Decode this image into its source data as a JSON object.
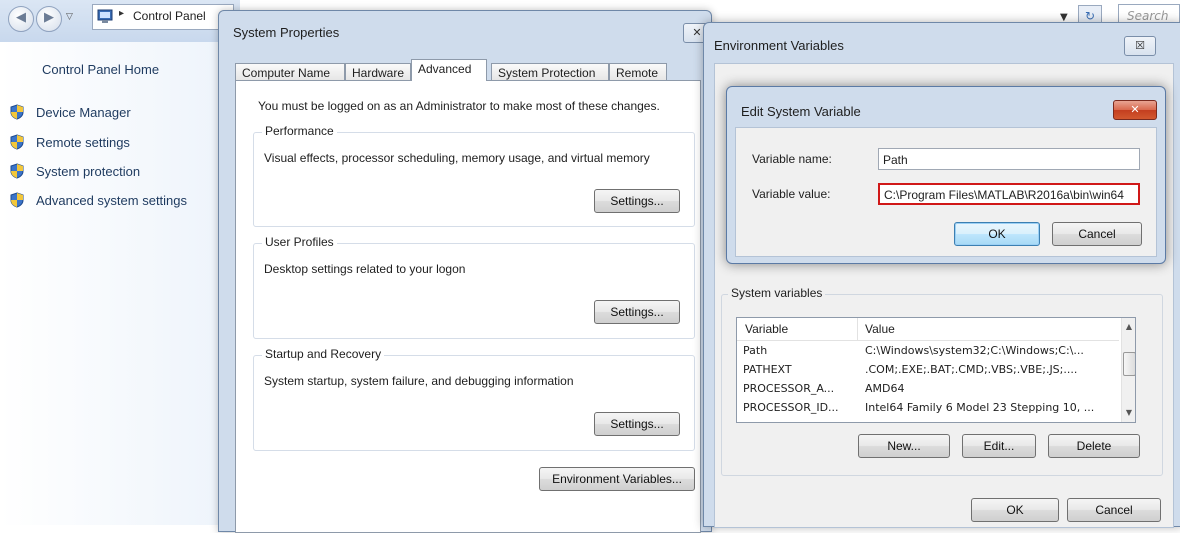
{
  "control_panel": {
    "breadcrumb": "Control Panel",
    "home_link": "Control Panel Home",
    "tasks": [
      {
        "label": "Device Manager"
      },
      {
        "label": "Remote settings"
      },
      {
        "label": "System protection"
      },
      {
        "label": "Advanced system settings"
      }
    ],
    "search_placeholder": "Search C"
  },
  "system_properties": {
    "title": "System Properties",
    "tabs": [
      {
        "label": "Computer Name"
      },
      {
        "label": "Hardware"
      },
      {
        "label": "Advanced"
      },
      {
        "label": "System Protection"
      },
      {
        "label": "Remote"
      }
    ],
    "active_tab": "Advanced",
    "admin_notice": "You must be logged on as an Administrator to make most of these changes.",
    "performance": {
      "title": "Performance",
      "description": "Visual effects, processor scheduling, memory usage, and virtual memory",
      "button": "Settings..."
    },
    "user_profiles": {
      "title": "User Profiles",
      "description": "Desktop settings related to your logon",
      "button": "Settings..."
    },
    "startup_recovery": {
      "title": "Startup and Recovery",
      "description": "System startup, system failure, and debugging information",
      "button": "Settings..."
    },
    "env_button": "Environment Variables..."
  },
  "environment_variables": {
    "title": "Environment Variables",
    "close": "☒",
    "system_variables": {
      "title": "System variables",
      "columns": [
        "Variable",
        "Value"
      ],
      "rows": [
        {
          "variable": "Path",
          "value": "C:\\Windows\\system32;C:\\Windows;C:\\..."
        },
        {
          "variable": "PATHEXT",
          "value": ".COM;.EXE;.BAT;.CMD;.VBS;.VBE;.JS;...."
        },
        {
          "variable": "PROCESSOR_A...",
          "value": "AMD64"
        },
        {
          "variable": "PROCESSOR_ID...",
          "value": "Intel64 Family 6 Model 23 Stepping 10, ..."
        }
      ],
      "buttons": {
        "new": "New...",
        "edit": "Edit...",
        "delete": "Delete"
      }
    },
    "ok": "OK",
    "cancel": "Cancel"
  },
  "edit_system_variable": {
    "title": "Edit System Variable",
    "name_label": "Variable name:",
    "name_value": "Path",
    "value_label": "Variable value:",
    "value_value": "C:\\Program Files\\MATLAB\\R2016a\\bin\\win64",
    "ok": "OK",
    "cancel": "Cancel",
    "highlight_color": "#d01818"
  },
  "colors": {
    "dialog_frame": "#cfdcec",
    "link_text": "#1e3a5f",
    "close_red": "#c43e1f"
  }
}
